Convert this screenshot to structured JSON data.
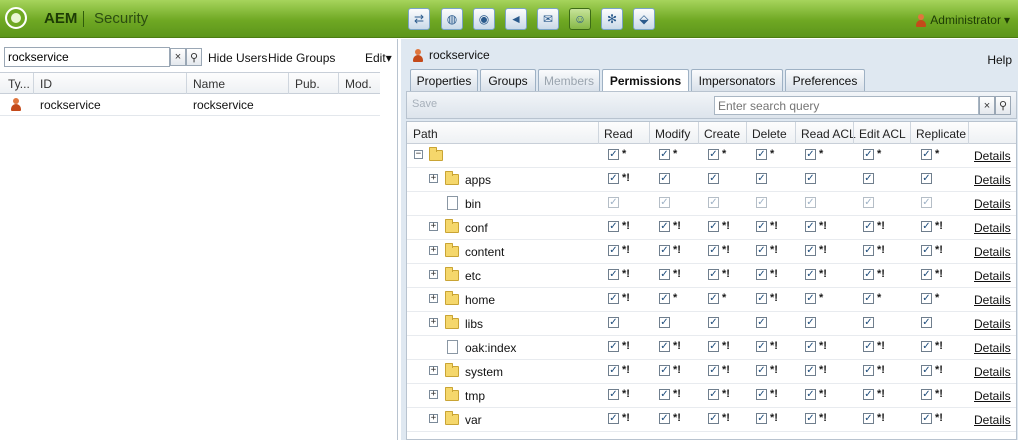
{
  "app": {
    "brand": "AEM",
    "section": "Security"
  },
  "toolbar_icons": [
    "users-icon",
    "globe-icon",
    "camera-icon",
    "megaphone-icon",
    "mail-icon",
    "users-security-icon",
    "gear-icon",
    "tag-icon"
  ],
  "active_tool_index": 5,
  "user_menu": {
    "label": "Administrator"
  },
  "left": {
    "search_value": "rockservice",
    "clear": "×",
    "search_btn": "⚲",
    "hide_users": "Hide Users",
    "hide_groups": "Hide Groups",
    "edit": "Edit",
    "columns": [
      "Ty...",
      "ID",
      "Name",
      "Pub.",
      "Mod."
    ],
    "rows": [
      {
        "id": "rockservice",
        "name": "rockservice",
        "pub": "",
        "mod": ""
      }
    ]
  },
  "right": {
    "user_title": "rockservice",
    "help": "Help",
    "tabs": [
      {
        "label": "Properties",
        "state": "normal"
      },
      {
        "label": "Groups",
        "state": "normal"
      },
      {
        "label": "Members",
        "state": "disabled"
      },
      {
        "label": "Permissions",
        "state": "active"
      },
      {
        "label": "Impersonators",
        "state": "normal"
      },
      {
        "label": "Preferences",
        "state": "normal"
      }
    ],
    "save": "Save",
    "search_placeholder": "Enter search query",
    "columns": [
      "Path",
      "Read",
      "Modify",
      "Create",
      "Delete",
      "Read ACL",
      "Edit ACL",
      "Replicate"
    ],
    "details_label": "Details",
    "rows": [
      {
        "name": "",
        "type": "root",
        "exp": "−",
        "marks": [
          "*",
          "*",
          "*",
          "*",
          "*",
          "*",
          "*"
        ],
        "disabled": false
      },
      {
        "name": "apps",
        "type": "folder",
        "exp": "+",
        "marks": [
          "*!",
          "",
          "",
          "",
          "",
          "",
          ""
        ],
        "disabled": false
      },
      {
        "name": "bin",
        "type": "file",
        "exp": "",
        "marks": [
          "",
          "",
          "",
          "",
          "",
          "",
          ""
        ],
        "disabled": true
      },
      {
        "name": "conf",
        "type": "folder",
        "exp": "+",
        "marks": [
          "*!",
          "*!",
          "*!",
          "*!",
          "*!",
          "*!",
          "*!"
        ],
        "disabled": false
      },
      {
        "name": "content",
        "type": "folder",
        "exp": "+",
        "marks": [
          "*!",
          "*!",
          "*!",
          "*!",
          "*!",
          "*!",
          "*!"
        ],
        "disabled": false
      },
      {
        "name": "etc",
        "type": "folder",
        "exp": "+",
        "marks": [
          "*!",
          "*!",
          "*!",
          "*!",
          "*!",
          "*!",
          "*!"
        ],
        "disabled": false
      },
      {
        "name": "home",
        "type": "folder",
        "exp": "+",
        "marks": [
          "*!",
          "*",
          "*",
          "*!",
          "*",
          "*",
          "*"
        ],
        "disabled": false
      },
      {
        "name": "libs",
        "type": "folder",
        "exp": "+",
        "marks": [
          "",
          "",
          "",
          "",
          "",
          "",
          ""
        ],
        "disabled": false
      },
      {
        "name": "oak:index",
        "type": "file",
        "exp": "",
        "marks": [
          "*!",
          "*!",
          "*!",
          "*!",
          "*!",
          "*!",
          "*!"
        ],
        "disabled": false
      },
      {
        "name": "system",
        "type": "folder",
        "exp": "+",
        "marks": [
          "*!",
          "*!",
          "*!",
          "*!",
          "*!",
          "*!",
          "*!"
        ],
        "disabled": false
      },
      {
        "name": "tmp",
        "type": "folder",
        "exp": "+",
        "marks": [
          "*!",
          "*!",
          "*!",
          "*!",
          "*!",
          "*!",
          "*!"
        ],
        "disabled": false
      },
      {
        "name": "var",
        "type": "folder",
        "exp": "+",
        "marks": [
          "*!",
          "*!",
          "*!",
          "*!",
          "*!",
          "*!",
          "*!"
        ],
        "disabled": false
      }
    ]
  }
}
